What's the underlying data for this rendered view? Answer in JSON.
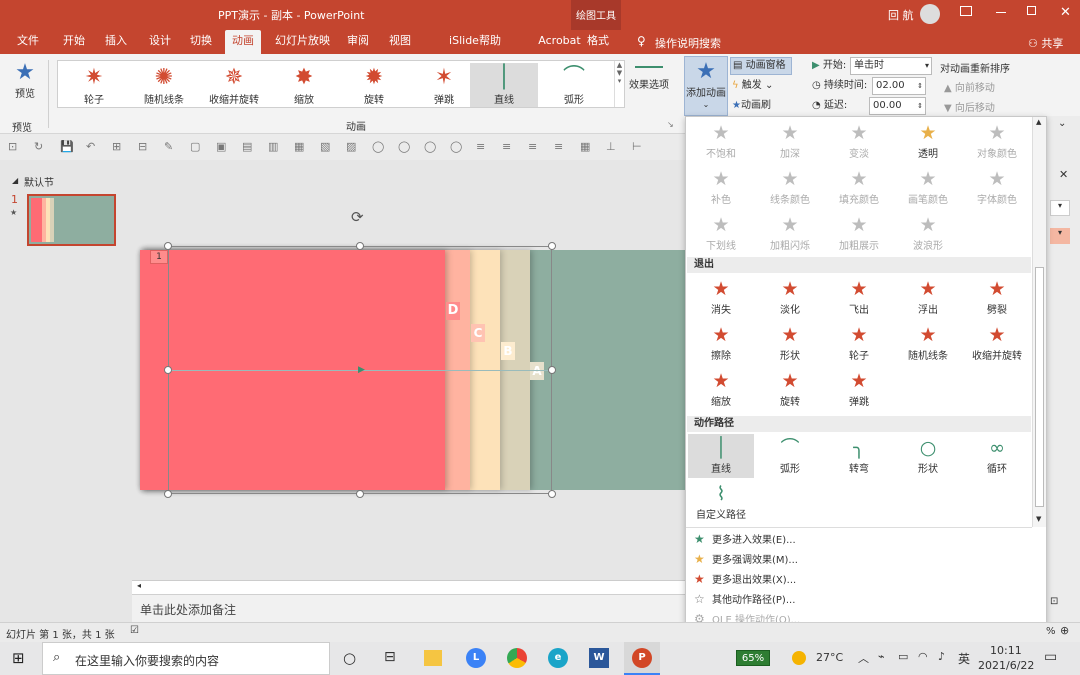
{
  "window": {
    "title": "PPT演示 - 副本  -  PowerPoint",
    "tool_title": "绘图工具",
    "user": "回 航",
    "colors": {
      "accent": "#c4452f",
      "star": "#d24b31",
      "slide_green": "#8eaea0",
      "slide_red": "#ff6b74"
    }
  },
  "tabs": [
    "文件",
    "开始",
    "插入",
    "设计",
    "切换",
    "动画",
    "幻灯片放映",
    "审阅",
    "视图",
    "iSlide",
    "帮助",
    "Acrobat",
    "格式"
  ],
  "active_tab": "动画",
  "tell_me": "操作说明搜索",
  "share": "共享",
  "ribbon": {
    "preview": "预览",
    "preview_group": "预览",
    "gallery": [
      {
        "label": "轮子",
        "icon": "star-wheel-icon"
      },
      {
        "label": "随机线条",
        "icon": "star-lines-icon"
      },
      {
        "label": "收缩并旋转",
        "icon": "star-shrink-icon"
      },
      {
        "label": "缩放",
        "icon": "star-zoom-icon"
      },
      {
        "label": "旋转",
        "icon": "star-spin-icon"
      },
      {
        "label": "弹跳",
        "icon": "star-bounce-icon"
      },
      {
        "label": "直线",
        "icon": "line-path-icon"
      },
      {
        "label": "弧形",
        "icon": "arc-path-icon"
      }
    ],
    "group_label": "动画",
    "effect_options": "效果选项",
    "add_animation": "添加动画",
    "anim_pane": "动画窗格",
    "trigger": "触发",
    "painter": "动画刷",
    "start_label": "开始:",
    "start_value": "单击时",
    "duration_label": "持续时间:",
    "duration_value": "02.00",
    "delay_label": "延迟:",
    "delay_value": "00.00",
    "reorder": "对动画重新排序",
    "move_earlier": "向前移动",
    "move_later": "向后移动"
  },
  "slide_panel": {
    "section": "默认节",
    "slide_num": "1"
  },
  "slide": {
    "tag": "1",
    "letters": [
      "D",
      "C",
      "B",
      "A"
    ]
  },
  "notes_placeholder": "单击此处添加备注",
  "status": {
    "slide_info": "幻灯片 第 1 张，共 1 张",
    "zoom_pct": "%"
  },
  "dropdown": {
    "emphasis": [
      {
        "label": "不饱和",
        "dis": true
      },
      {
        "label": "加深",
        "dis": true
      },
      {
        "label": "变淡",
        "dis": true
      },
      {
        "label": "透明",
        "dis": false
      },
      {
        "label": "对象颜色",
        "dis": true
      },
      {
        "label": "补色",
        "dis": true
      },
      {
        "label": "线条颜色",
        "dis": true
      },
      {
        "label": "填充颜色",
        "dis": true
      },
      {
        "label": "画笔颜色",
        "dis": true
      },
      {
        "label": "字体颜色",
        "dis": true
      },
      {
        "label": "下划线",
        "dis": true
      },
      {
        "label": "加粗闪烁",
        "dis": true
      },
      {
        "label": "加粗展示",
        "dis": true
      },
      {
        "label": "波浪形",
        "dis": true
      }
    ],
    "exit_header": "退出",
    "exit": [
      "消失",
      "淡化",
      "飞出",
      "浮出",
      "劈裂",
      "擦除",
      "形状",
      "轮子",
      "随机线条",
      "收缩并旋转",
      "缩放",
      "旋转",
      "弹跳"
    ],
    "path_header": "动作路径",
    "paths": [
      "直线",
      "弧形",
      "转弯",
      "形状",
      "循环",
      "自定义路径"
    ],
    "more": [
      {
        "label": "更多进入效果(E)...",
        "color": "#3d8f6e",
        "dis": false
      },
      {
        "label": "更多强调效果(M)...",
        "color": "#e8b04a",
        "dis": false
      },
      {
        "label": "更多退出效果(X)...",
        "color": "#d24b31",
        "dis": false
      },
      {
        "label": "其他动作路径(P)...",
        "color": "#777777",
        "dis": false
      },
      {
        "label": "OLE 操作动作(O)...",
        "color": "#aaaaaa",
        "dis": true
      }
    ]
  },
  "taskbar": {
    "search": "在这里输入你要搜索的内容",
    "battery": "65%",
    "temp": "27°C",
    "ime": "英",
    "time": "10:11",
    "date": "2021/6/22"
  }
}
